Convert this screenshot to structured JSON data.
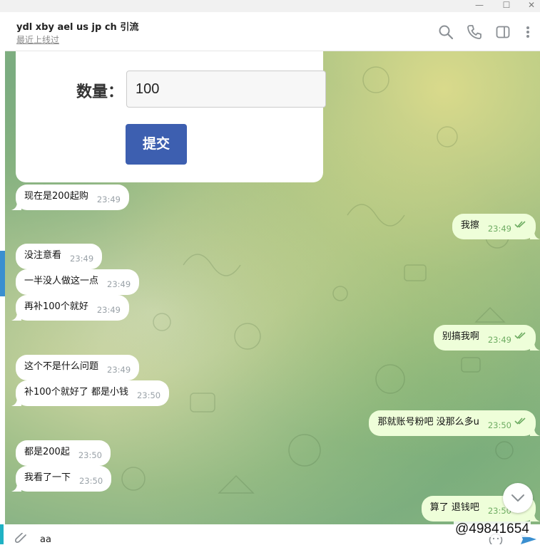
{
  "window": {
    "minimize_label": "—",
    "maximize_label": "☐",
    "close_label": "✕"
  },
  "header": {
    "title": "ydl xby ael us jp ch 引流",
    "status": "最近上线过",
    "icons": [
      "search-icon",
      "phone-icon",
      "sidebar-toggle-icon",
      "more-vertical-icon"
    ]
  },
  "form": {
    "quantity_label": "数量：",
    "quantity_value": "100",
    "submit_label": "提交"
  },
  "messages": [
    {
      "dir": "in",
      "text": "现在是200起购",
      "time": "23:49"
    },
    {
      "dir": "out",
      "text": "我擦",
      "time": "23:49",
      "read": true
    },
    {
      "dir": "in",
      "text": "没注意看",
      "time": "23:49"
    },
    {
      "dir": "in",
      "text": "一半没人做这一点",
      "time": "23:49"
    },
    {
      "dir": "in",
      "text": "再补100个就好",
      "time": "23:49"
    },
    {
      "dir": "out",
      "text": "别搞我啊",
      "time": "23:49",
      "read": true
    },
    {
      "dir": "in",
      "text": "这个不是什么问题",
      "time": "23:49"
    },
    {
      "dir": "in",
      "text": "补100个就好了 都是小钱",
      "time": "23:50"
    },
    {
      "dir": "out",
      "text": "那就账号粉吧 没那么多u",
      "time": "23:50",
      "read": true
    },
    {
      "dir": "in",
      "text": "都是200起",
      "time": "23:50"
    },
    {
      "dir": "in",
      "text": "我看了一下",
      "time": "23:50"
    },
    {
      "dir": "out",
      "text": "算了 退钱吧",
      "time": "23:50",
      "read": true
    }
  ],
  "composer": {
    "text": "aa"
  },
  "watermark": "@49841654",
  "colors": {
    "incoming_bubble": "#ffffff",
    "outgoing_bubble": "#eefed9",
    "read_ticks": "#6fad63",
    "submit_button": "#3d5fb0",
    "accent": "#3a8fd0"
  }
}
